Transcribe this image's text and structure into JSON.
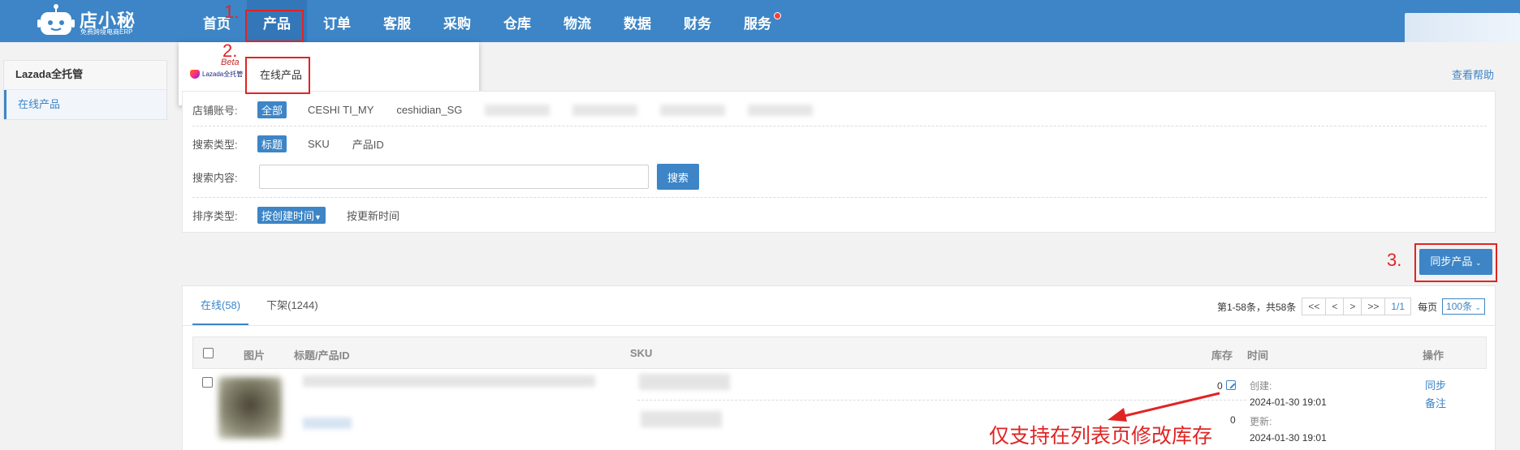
{
  "app": {
    "name": "店小秘",
    "slogan": "免费跨境电商ERP"
  },
  "nav": {
    "items": [
      {
        "label": "首页"
      },
      {
        "label": "产品"
      },
      {
        "label": "订单"
      },
      {
        "label": "客服"
      },
      {
        "label": "采购"
      },
      {
        "label": "仓库"
      },
      {
        "label": "物流"
      },
      {
        "label": "数据"
      },
      {
        "label": "财务"
      },
      {
        "label": "服务"
      }
    ],
    "active": "产品"
  },
  "dropdown": {
    "brand": "Lazada全托管",
    "beta": "Beta",
    "item": "在线产品"
  },
  "steps": {
    "one": "1.",
    "two": "2.",
    "three": "3."
  },
  "sidebar": {
    "title": "Lazada全托管",
    "items": [
      {
        "label": "在线产品"
      }
    ]
  },
  "help_link": "查看帮助",
  "filters": {
    "shop": {
      "label": "店铺账号:",
      "options": [
        "全部",
        "CESHI TI_MY",
        "ceshidian_SG"
      ]
    },
    "search_type": {
      "label": "搜索类型:",
      "options": [
        "标题",
        "SKU",
        "产品ID"
      ]
    },
    "search_content": {
      "label": "搜索内容:",
      "placeholder": "",
      "button": "搜索"
    },
    "sort": {
      "label": "排序类型:",
      "options": [
        "按创建时间",
        "按更新时间"
      ]
    }
  },
  "sync_button": "同步产品",
  "tabs": [
    {
      "label": "在线(58)"
    },
    {
      "label": "下架(1244)"
    }
  ],
  "pager": {
    "summary": "第1-58条，共58条",
    "buttons": [
      "<<",
      "<",
      ">",
      ">>",
      "1/1"
    ],
    "per_page_label": "每页",
    "per_page": "100条"
  },
  "table": {
    "headers": {
      "image": "图片",
      "title": "标题/产品ID",
      "sku": "SKU",
      "stock": "库存",
      "time": "时间",
      "ops": "操作"
    },
    "rows": [
      {
        "stock_1": "0",
        "stock_2": "0",
        "created_label": "创建:",
        "created": "2024-01-30 19:01",
        "updated_label": "更新:",
        "updated": "2024-01-30 19:01",
        "op_sync": "同步",
        "op_note": "备注"
      }
    ]
  },
  "annotation": "仅支持在列表页修改库存",
  "colors": {
    "primary": "#3d85c6",
    "annotation_red": "#e02424"
  }
}
